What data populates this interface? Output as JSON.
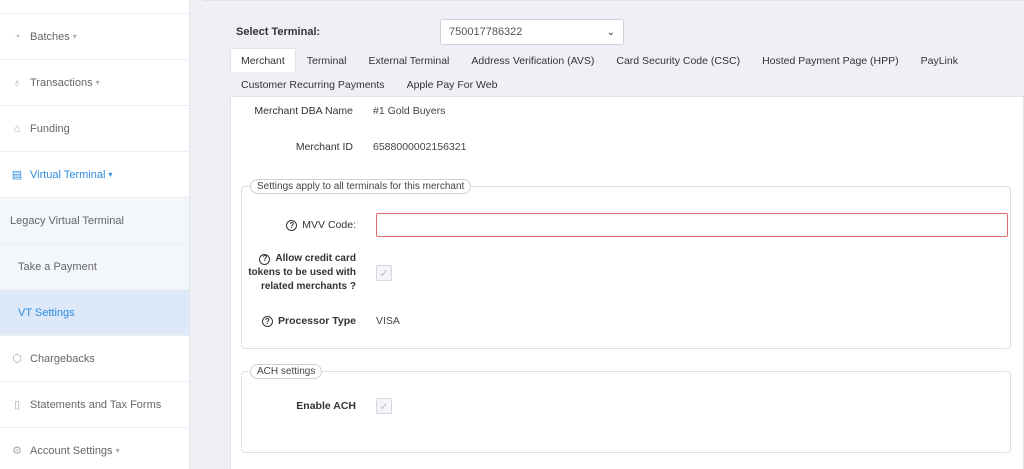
{
  "sidebar": {
    "items": [
      {
        "label": "Batches",
        "icon": "dashboard-icon",
        "caret": "▾"
      },
      {
        "label": "Transactions",
        "icon": "money-bag-icon",
        "caret": "▾"
      },
      {
        "label": "Funding",
        "icon": "bank-icon"
      },
      {
        "label": "Virtual Terminal",
        "icon": "terminal-icon",
        "caret": "▾"
      },
      {
        "label": "Legacy Virtual Terminal"
      },
      {
        "label": "Take a Payment"
      },
      {
        "label": "VT Settings"
      },
      {
        "label": "Chargebacks",
        "icon": "shield-icon"
      },
      {
        "label": "Statements and Tax Forms",
        "icon": "document-icon"
      },
      {
        "label": "Account Settings",
        "icon": "gear-icon",
        "caret": "▾"
      }
    ]
  },
  "terminal": {
    "label": "Select Terminal:",
    "value": "750017786322"
  },
  "tabs": {
    "row1": [
      "Merchant",
      "Terminal",
      "External Terminal",
      "Address Verification (AVS)",
      "Card Security Code (CSC)",
      "Hosted Payment Page (HPP)",
      "PayLink"
    ],
    "row2": [
      "Customer Recurring Payments",
      "Apple Pay For Web"
    ],
    "active": "Merchant"
  },
  "merchant": {
    "dba_label": "Merchant DBA Name",
    "dba_value": "#1 Gold Buyers",
    "id_label": "Merchant ID",
    "id_value": "6588000002156321"
  },
  "settings": {
    "legend": "Settings apply to all terminals for this merchant",
    "mvv_label": "MVV Code:",
    "mvv_value": "",
    "allow_line1": "Allow credit card",
    "allow_line2": "tokens to be used with",
    "allow_line3": "related merchants ?",
    "processor_label": "Processor Type",
    "processor_value": "VISA"
  },
  "ach": {
    "legend": "ACH settings",
    "enable_label": "Enable ACH"
  },
  "colors": {
    "accent": "#2d8cdf",
    "error_border": "#e06b6b",
    "selected_bg": "#dde8f8"
  }
}
